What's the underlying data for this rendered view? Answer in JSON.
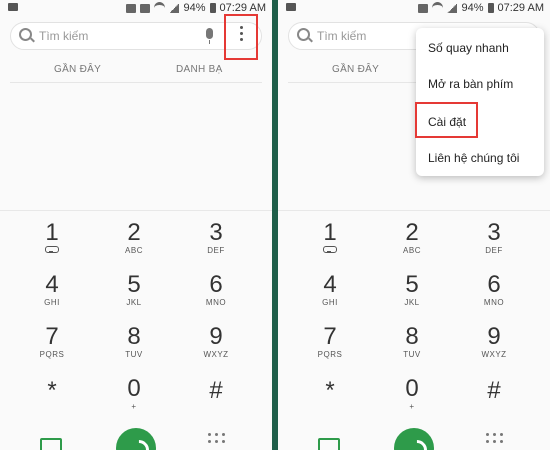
{
  "status_bar": {
    "battery": "94%",
    "time": "07:29 AM"
  },
  "search": {
    "placeholder": "Tìm kiếm"
  },
  "tabs": {
    "recent": "GẦN ĐÂY",
    "contacts": "DANH BẠ"
  },
  "keypad": [
    {
      "num": "1",
      "sub": ""
    },
    {
      "num": "2",
      "sub": "ABC"
    },
    {
      "num": "3",
      "sub": "DEF"
    },
    {
      "num": "4",
      "sub": "GHI"
    },
    {
      "num": "5",
      "sub": "JKL"
    },
    {
      "num": "6",
      "sub": "MNO"
    },
    {
      "num": "7",
      "sub": "PQRS"
    },
    {
      "num": "8",
      "sub": "TUV"
    },
    {
      "num": "9",
      "sub": "WXYZ"
    },
    {
      "num": "*",
      "sub": ""
    },
    {
      "num": "0",
      "sub": "+"
    },
    {
      "num": "#",
      "sub": ""
    }
  ],
  "menu": {
    "items": [
      "Số quay nhanh",
      "Mở ra bàn phím",
      "Cài đặt",
      "Liên hệ chúng tôi"
    ]
  },
  "colors": {
    "accent_green": "#2e9b4a",
    "highlight_red": "#e53935"
  }
}
